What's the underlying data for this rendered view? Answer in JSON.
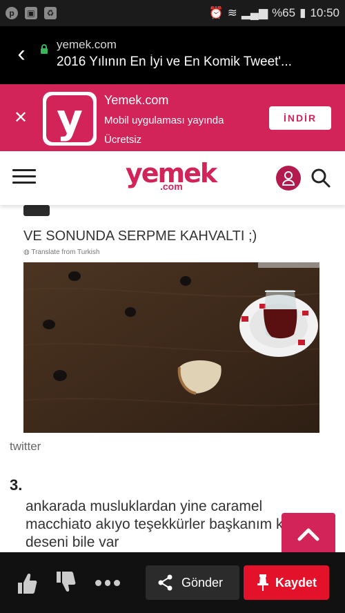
{
  "statusbar": {
    "battery_text": "%65",
    "time": "10:50"
  },
  "browser": {
    "domain": "yemek.com",
    "title": "2016 Yılının En İyi ve En Komik Tweet'..."
  },
  "app_banner": {
    "name": "Yemek.com",
    "description": "Mobil uygulaması yayında",
    "price": "Ücretsiz",
    "install_label": "İNDİR",
    "logo_letter": "y"
  },
  "site": {
    "logo_main": "yemek",
    "logo_sub": ".com"
  },
  "content": {
    "tweet_text": "VE SONUNDA SERPME KAHVALTI ;)",
    "translate_label": "Translate from Turkish",
    "source": "twitter",
    "item_number": "3.",
    "next_tweet_lines": [
      "ankarada musluklardan yine caramel",
      "macchiato akıyo teşekkürler başkanım k",
      "deseni bile var"
    ]
  },
  "bottom": {
    "send_label": "Gönder",
    "save_label": "Kaydet"
  },
  "colors": {
    "brand": "#d3245a",
    "save": "#e3122a"
  }
}
